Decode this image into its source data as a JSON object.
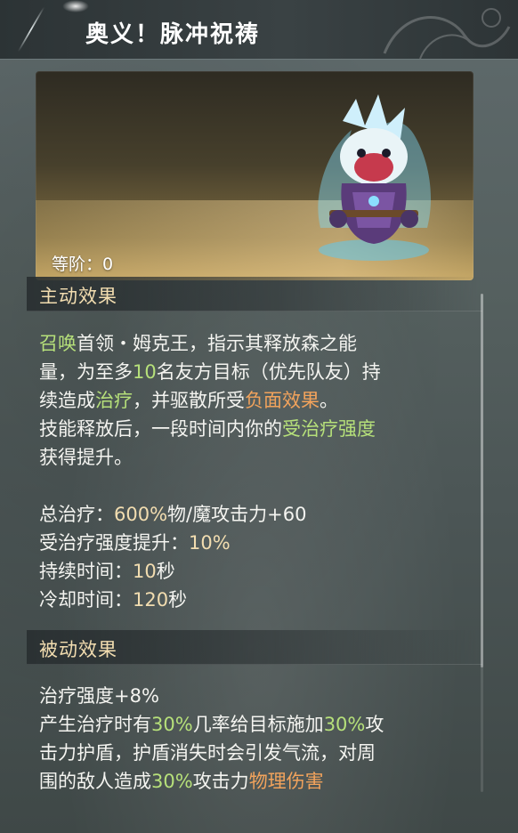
{
  "header": {
    "title": "奥义！脉冲祝祷"
  },
  "hero": {
    "rank_label": "等阶：0"
  },
  "active": {
    "section_title": "主动效果",
    "d1_a": "召唤",
    "d1_b": "首领・姆克王，指示其释放森之能",
    "d2_a": "量，为至多",
    "d2_b": "10",
    "d2_c": "名友方目标（优先队友）持",
    "d3_a": "续造成",
    "d3_b": "治疗",
    "d3_c": "，并驱散所受",
    "d3_d": "负面效果",
    "d3_e": "。",
    "d4_a": "技能释放后，一段时间内你的",
    "d4_b": "受治疗强度",
    "d5": "获得提升。",
    "stats": [
      {
        "label": "总治疗：",
        "value": "600%",
        "suffix": "物/魔攻击力+60"
      },
      {
        "label": "受治疗强度提升：",
        "value": "10%",
        "suffix": ""
      },
      {
        "label": "持续时间：",
        "value": "10",
        "suffix": "秒"
      },
      {
        "label": "冷却时间：",
        "value": "120",
        "suffix": "秒"
      }
    ]
  },
  "passive": {
    "section_title": "被动效果",
    "p1": "治疗强度+8%",
    "p2_a": "产生治疗时有",
    "p2_b": "30%",
    "p2_c": "几率给目标施加",
    "p2_d": "30%",
    "p2_e": "攻",
    "p3": "击力护盾，护盾消失时会引发气流，对周",
    "p4_a": "围的敌人造成",
    "p4_b": "30%",
    "p4_c": "攻击力",
    "p4_d": "物理伤害"
  },
  "colors": {
    "highlight_green": "#b6e07a",
    "highlight_orange": "#f2a35c",
    "highlight_gold": "#f2ddb0"
  }
}
